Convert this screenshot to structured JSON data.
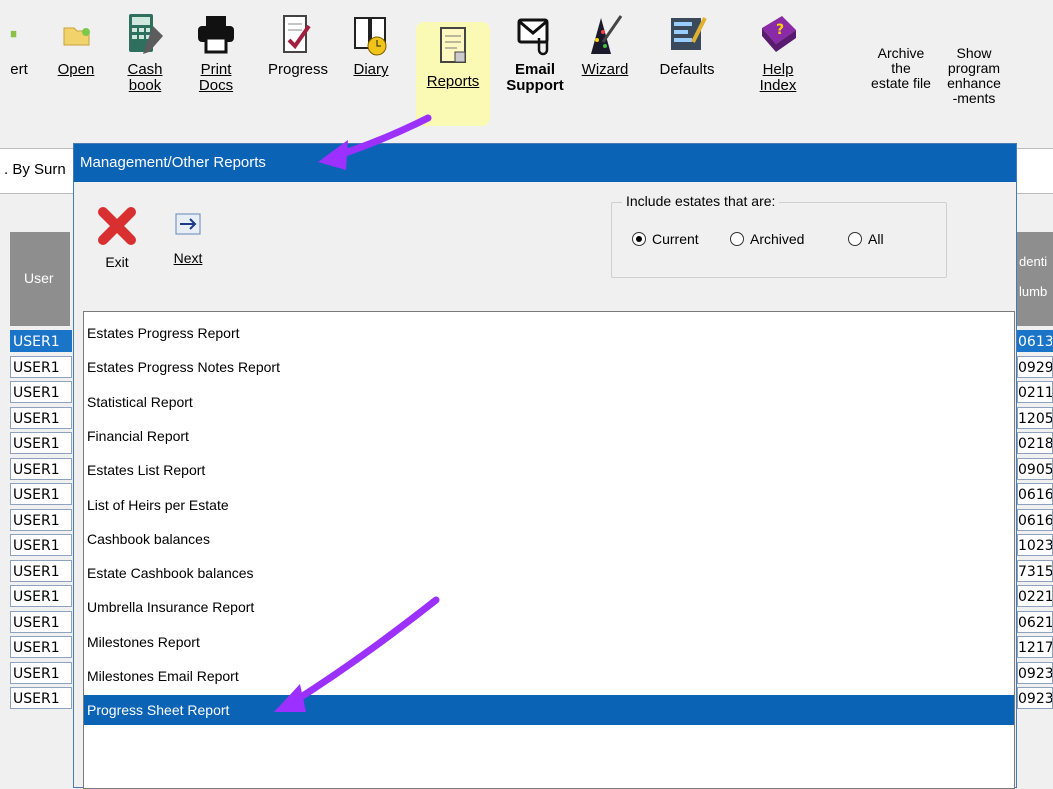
{
  "toolbar": {
    "items": [
      {
        "id": "insert",
        "label": "ert",
        "icon": "insert-icon"
      },
      {
        "id": "open",
        "label": "Open",
        "icon": "folder-open-icon"
      },
      {
        "id": "cashbook",
        "label": "Cash\nbook",
        "icon": "cashbook-icon"
      },
      {
        "id": "printdocs",
        "label": "Print\nDocs",
        "icon": "printer-icon"
      },
      {
        "id": "progress",
        "label": "Progress",
        "icon": "progress-icon"
      },
      {
        "id": "diary",
        "label": "Diary",
        "icon": "diary-icon"
      },
      {
        "id": "reports",
        "label": "Reports",
        "icon": "reports-icon"
      },
      {
        "id": "email",
        "label": "Email\nSupport",
        "icon": "email-icon"
      },
      {
        "id": "wizard",
        "label": "Wizard",
        "icon": "wizard-icon"
      },
      {
        "id": "defaults",
        "label": "Defaults",
        "icon": "defaults-icon"
      },
      {
        "id": "help",
        "label": "Help\nIndex",
        "icon": "help-book-icon"
      }
    ],
    "archive_label": "Archive\nthe\nestate file",
    "show_label": "Show\nprogram\nenhance\n-ments"
  },
  "background": {
    "search_text": ". By Surn",
    "grid_header_left": "User",
    "grid_header_right": [
      "denti",
      "lumb"
    ],
    "rows_left": [
      "USER1",
      "USER1",
      "USER1",
      "USER1",
      "USER1",
      "USER1",
      "USER1",
      "USER1",
      "USER1",
      "USER1",
      "USER1",
      "USER1",
      "USER1",
      "USER1",
      "USER1"
    ],
    "rows_right": [
      "0613",
      "0929",
      "0211",
      "1205",
      "0218",
      "0905",
      "0616",
      "0616",
      "1023",
      "7315",
      "0221",
      "0621",
      "1217",
      "0923",
      "0923"
    ]
  },
  "dialog": {
    "title": "Management/Other Reports",
    "exit_label": "Exit",
    "next_label": "Next",
    "include_label": "Include estates that are:",
    "radios": [
      {
        "label": "Current",
        "checked": true
      },
      {
        "label": "Archived",
        "checked": false
      },
      {
        "label": "All",
        "checked": false
      }
    ],
    "reports": [
      "Estates Progress Report",
      "Estates Progress Notes Report",
      "Statistical Report",
      "Financial Report",
      "Estates List Report",
      "List of Heirs per Estate",
      "Cashbook balances",
      "Estate Cashbook balances",
      "Umbrella Insurance Report",
      "Milestones Report",
      "Milestones Email Report",
      "Progress Sheet Report"
    ],
    "selected_report": "Progress Sheet Report"
  },
  "colors": {
    "titlebar": "#0b63b6",
    "selection": "#0b63b6",
    "arrow": "#9b30ff",
    "reports_highlight": "#fafab4"
  }
}
